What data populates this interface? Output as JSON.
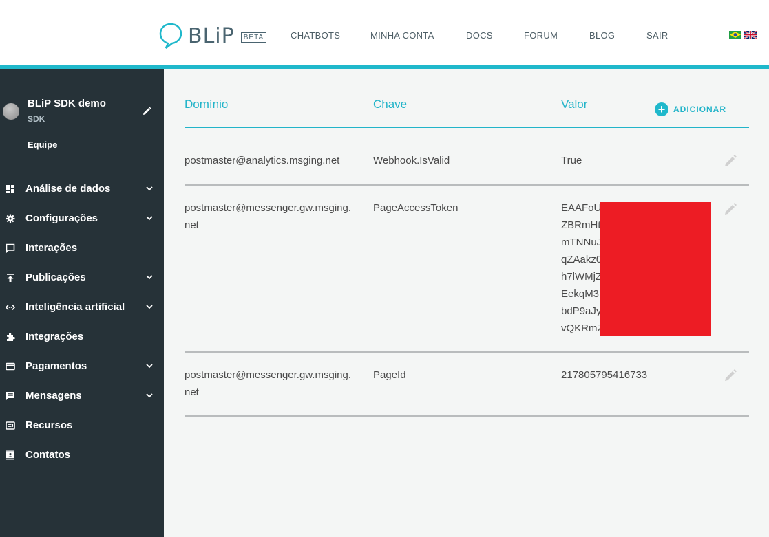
{
  "header": {
    "logo_text": "BLiP",
    "badge": "BETA",
    "nav": [
      "CHATBOTS",
      "MINHA CONTA",
      "DOCS",
      "FORUM",
      "BLOG",
      "SAIR"
    ],
    "accent_color": "#1fb8cb"
  },
  "sidebar": {
    "bot_name": "BLiP SDK demo",
    "bot_type": "SDK",
    "team_label": "Equipe",
    "items": [
      {
        "label": "Análise de dados",
        "icon": "dashboard-icon",
        "expandable": true
      },
      {
        "label": "Configurações",
        "icon": "gear-icon",
        "expandable": true
      },
      {
        "label": "Interações",
        "icon": "chat-bubble-icon",
        "expandable": false
      },
      {
        "label": "Publicações",
        "icon": "publish-icon",
        "expandable": true
      },
      {
        "label": "Inteligência artificial",
        "icon": "code-arrows-icon",
        "expandable": true
      },
      {
        "label": "Integrações",
        "icon": "puzzle-icon",
        "expandable": false
      },
      {
        "label": "Pagamentos",
        "icon": "credit-card-icon",
        "expandable": true
      },
      {
        "label": "Mensagens",
        "icon": "message-icon",
        "expandable": true
      },
      {
        "label": "Recursos",
        "icon": "resources-icon",
        "expandable": false
      },
      {
        "label": "Contatos",
        "icon": "contacts-icon",
        "expandable": false
      }
    ]
  },
  "table": {
    "headers": {
      "domain": "Domínio",
      "key": "Chave",
      "value": "Valor"
    },
    "add_label": "ADICIONAR",
    "rows": [
      {
        "domain": "postmaster@analytics.msging.net",
        "key": "Webhook.IsValid",
        "value": [
          "True"
        ]
      },
      {
        "domain": "postmaster@messenger.gw.msging.net",
        "key": "PageAccessToken",
        "value": [
          "EAAFoU",
          "ZBRmHt",
          "mTNNuJ",
          "qZAakz0",
          "h7lWMjZ",
          "EekqM3",
          "bdP9aJy",
          "vQKRmZ"
        ]
      },
      {
        "domain": "postmaster@messenger.gw.msging.net",
        "key": "PageId",
        "value": [
          "217805795416733"
        ]
      }
    ]
  }
}
